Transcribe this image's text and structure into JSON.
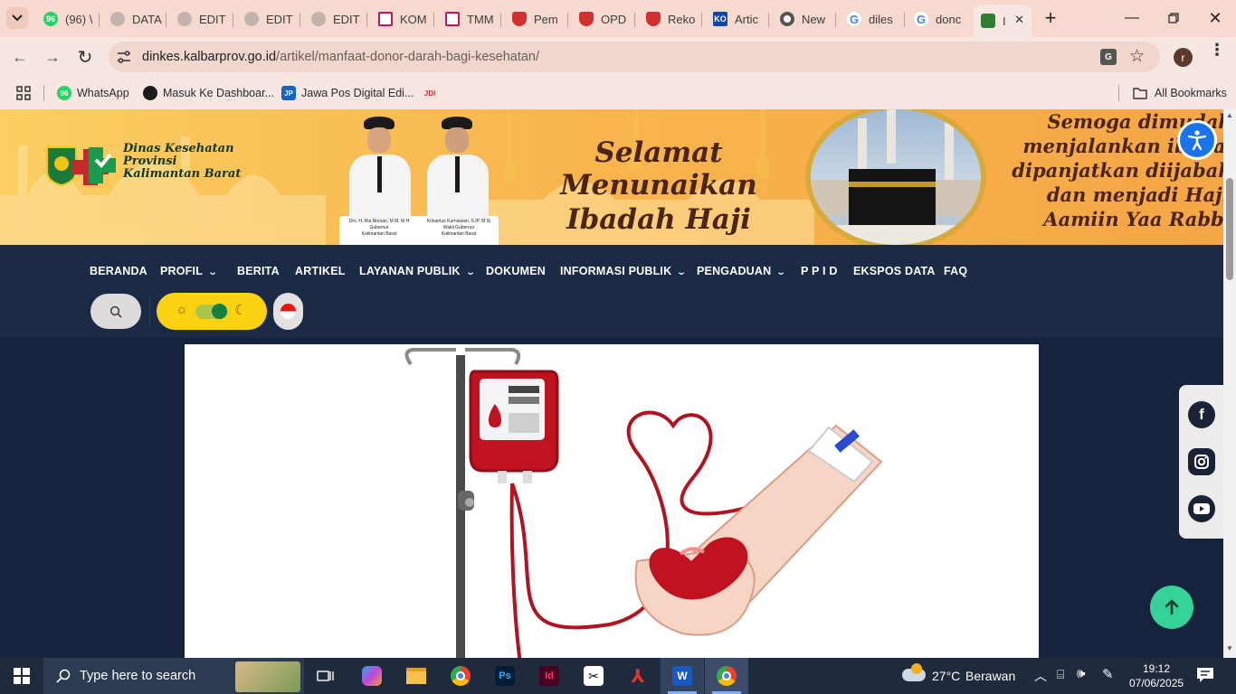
{
  "browser": {
    "tabs": [
      {
        "label": "(96) \\",
        "favicon": "whatsapp-icon",
        "color": "#25d366",
        "badge": "96"
      },
      {
        "label": "DATA",
        "favicon": "globe-icon",
        "color": "#9aa0a6"
      },
      {
        "label": "EDIT",
        "favicon": "globe-icon",
        "color": "#9aa0a6"
      },
      {
        "label": "EDIT",
        "favicon": "globe-icon",
        "color": "#9aa0a6"
      },
      {
        "label": "EDIT",
        "favicon": "globe-icon",
        "color": "#9aa0a6"
      },
      {
        "label": "KOM",
        "favicon": "site-icon",
        "color": "#c2185b"
      },
      {
        "label": "TMM",
        "favicon": "site-icon",
        "color": "#c2185b"
      },
      {
        "label": "Pem",
        "favicon": "shield-icon",
        "color": "#d32f2f"
      },
      {
        "label": "OPD",
        "favicon": "shield-icon",
        "color": "#d32f2f"
      },
      {
        "label": "Reko",
        "favicon": "shield-icon",
        "color": "#d32f2f"
      },
      {
        "label": "Artic",
        "favicon": "ko-icon",
        "color": "#1565c0"
      },
      {
        "label": "New",
        "favicon": "chrome-icon",
        "color": "#555555"
      },
      {
        "label": "diles",
        "favicon": "google-icon",
        "color": "#4285f4"
      },
      {
        "label": "donc",
        "favicon": "google-icon",
        "color": "#4285f4"
      },
      {
        "label": "I",
        "favicon": "dinkes-icon",
        "color": "#2e7d32",
        "active": true
      }
    ],
    "url_host": "dinkes.kalbarprov.go.id",
    "url_path": "/artikel/manfaat-donor-darah-bagi-kesehatan/",
    "profile_initial": "r",
    "bookmarks": [
      {
        "label": "WhatsApp",
        "icon": "whatsapp-icon",
        "badge": "96"
      },
      {
        "label": "Masuk Ke Dashboar...",
        "icon": "dashboard-icon"
      },
      {
        "label": "Jawa Pos Digital Edi...",
        "icon": "jawapos-icon",
        "badge": "JP"
      },
      {
        "label": "",
        "icon": "jdih-icon",
        "badge": "JDI"
      }
    ],
    "all_bookmarks": "All Bookmarks"
  },
  "site": {
    "logo_line1": "Dinas Kesehatan",
    "logo_line2": "Provinsi",
    "logo_line3": "Kalimantan Barat",
    "person1_name": "Drs. H. Ria Norsan, M.M, M.H",
    "person1_title": "Gubernur",
    "person1_region": "Kalimantan Barat",
    "person2_name": "Krisantus Kurniawan, S.IP, M.Si",
    "person2_title": "Wakil Gubernur",
    "person2_region": "Kalimantan Barat",
    "greeting_line1": "Selamat Menunaikan",
    "greeting_line2": "Ibadah Haji",
    "wish_line1": "Semoga dimudahkan",
    "wish_line2": "menjalankan ibadah hajinya,",
    "wish_line3": "dipanjatkan diijabah Allah",
    "wish_line4": "dan menjadi Haji Mabrur",
    "wish_line5": "Aamiin Yaa Rabbal Alamin",
    "nav": [
      {
        "label": "BERANDA",
        "dropdown": false
      },
      {
        "label": "PROFIL",
        "dropdown": true
      },
      {
        "label": "BERITA",
        "dropdown": false
      },
      {
        "label": "ARTIKEL",
        "dropdown": false
      },
      {
        "label": "LAYANAN PUBLIK",
        "dropdown": true
      },
      {
        "label": "DOKUMEN",
        "dropdown": false
      },
      {
        "label": "INFORMASI PUBLIK",
        "dropdown": true
      },
      {
        "label": "PENGADUAN",
        "dropdown": true
      },
      {
        "label": "P P I D",
        "dropdown": false
      },
      {
        "label": "EKSPOS DATA",
        "dropdown": false
      },
      {
        "label": "FAQ",
        "dropdown": false
      }
    ],
    "toggle_state": "light",
    "colors": {
      "nav_bg": "#1b2b45",
      "page_bg": "#16233c",
      "toggle": "#fcd213",
      "toggle_knob": "#15803d",
      "back_to_top": "#36d399"
    }
  },
  "taskbar": {
    "search_placeholder": "Type here to search",
    "weather_temp": "27°C",
    "weather_text": "Berawan",
    "time": "19:12",
    "date": "07/06/2025"
  }
}
